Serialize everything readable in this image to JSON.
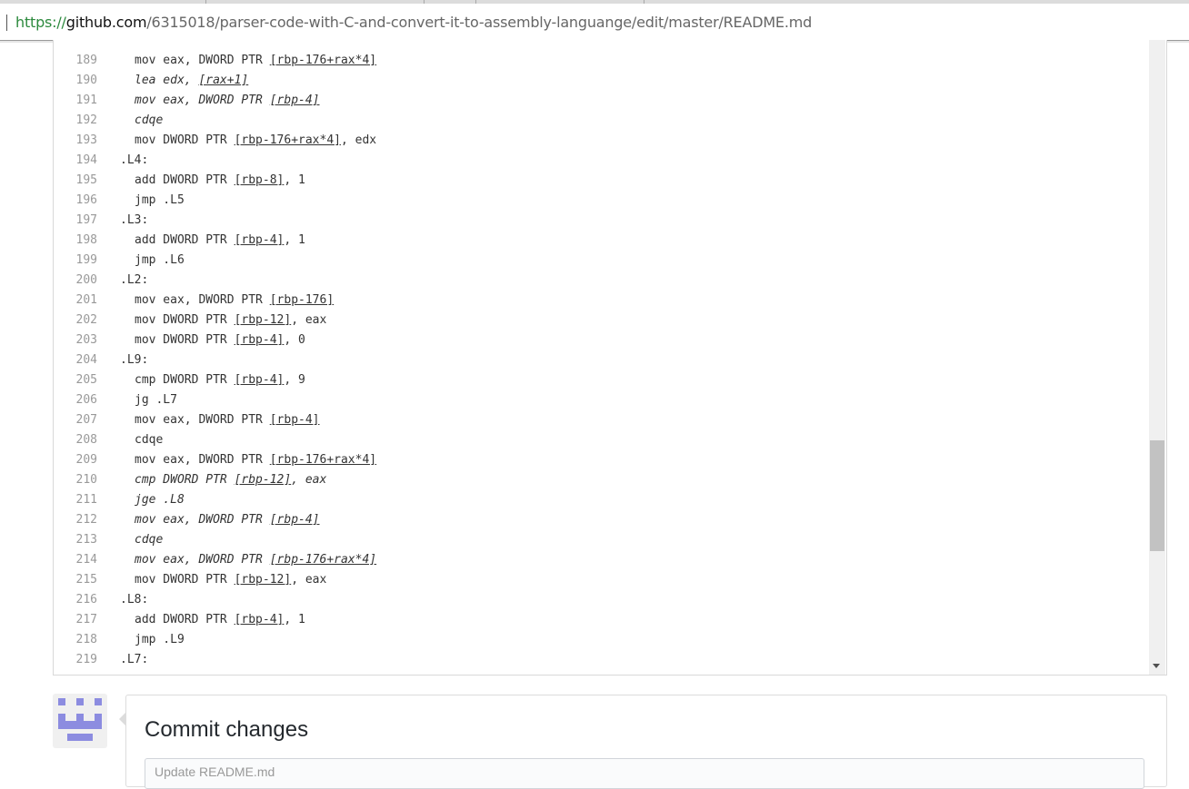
{
  "browser": {
    "url_scheme": "https://",
    "url_host": "github.com",
    "url_path": "/6315018/parser-code-with-C-and-convert-it-to-assembly-languange/edit/master/README.md"
  },
  "editor": {
    "lines": [
      {
        "n": "189",
        "indent": true,
        "italic": false,
        "segs": [
          {
            "t": "mov eax, DWORD PTR "
          },
          {
            "t": "[rbp-176+rax*4]",
            "m": true
          }
        ]
      },
      {
        "n": "190",
        "indent": true,
        "italic": true,
        "segs": [
          {
            "t": "lea edx, "
          },
          {
            "t": "[rax+1]",
            "m": true
          }
        ]
      },
      {
        "n": "191",
        "indent": true,
        "italic": true,
        "segs": [
          {
            "t": "mov eax, DWORD PTR "
          },
          {
            "t": "[rbp-4]",
            "m": true
          }
        ]
      },
      {
        "n": "192",
        "indent": true,
        "italic": true,
        "segs": [
          {
            "t": "cdqe"
          }
        ]
      },
      {
        "n": "193",
        "indent": true,
        "italic": false,
        "segs": [
          {
            "t": "mov DWORD PTR "
          },
          {
            "t": "[rbp-176+rax*4]",
            "m": true
          },
          {
            "t": ", edx"
          }
        ]
      },
      {
        "n": "194",
        "indent": false,
        "italic": false,
        "segs": [
          {
            "t": ".L4:"
          }
        ]
      },
      {
        "n": "195",
        "indent": true,
        "italic": false,
        "segs": [
          {
            "t": "add DWORD PTR "
          },
          {
            "t": "[rbp-8]",
            "m": true
          },
          {
            "t": ", 1"
          }
        ]
      },
      {
        "n": "196",
        "indent": true,
        "italic": false,
        "segs": [
          {
            "t": "jmp .L5"
          }
        ]
      },
      {
        "n": "197",
        "indent": false,
        "italic": false,
        "segs": [
          {
            "t": ".L3:"
          }
        ]
      },
      {
        "n": "198",
        "indent": true,
        "italic": false,
        "segs": [
          {
            "t": "add DWORD PTR "
          },
          {
            "t": "[rbp-4]",
            "m": true
          },
          {
            "t": ", 1"
          }
        ]
      },
      {
        "n": "199",
        "indent": true,
        "italic": false,
        "segs": [
          {
            "t": "jmp .L6"
          }
        ]
      },
      {
        "n": "200",
        "indent": false,
        "italic": false,
        "segs": [
          {
            "t": ".L2:"
          }
        ]
      },
      {
        "n": "201",
        "indent": true,
        "italic": false,
        "segs": [
          {
            "t": "mov eax, DWORD PTR "
          },
          {
            "t": "[rbp-176]",
            "m": true
          }
        ]
      },
      {
        "n": "202",
        "indent": true,
        "italic": false,
        "segs": [
          {
            "t": "mov DWORD PTR "
          },
          {
            "t": "[rbp-12]",
            "m": true
          },
          {
            "t": ", eax"
          }
        ]
      },
      {
        "n": "203",
        "indent": true,
        "italic": false,
        "segs": [
          {
            "t": "mov DWORD PTR "
          },
          {
            "t": "[rbp-4]",
            "m": true
          },
          {
            "t": ", 0"
          }
        ]
      },
      {
        "n": "204",
        "indent": false,
        "italic": false,
        "segs": [
          {
            "t": ".L9:"
          }
        ]
      },
      {
        "n": "205",
        "indent": true,
        "italic": false,
        "segs": [
          {
            "t": "cmp DWORD PTR "
          },
          {
            "t": "[rbp-4]",
            "m": true
          },
          {
            "t": ", 9"
          }
        ]
      },
      {
        "n": "206",
        "indent": true,
        "italic": false,
        "segs": [
          {
            "t": "jg .L7"
          }
        ]
      },
      {
        "n": "207",
        "indent": true,
        "italic": false,
        "segs": [
          {
            "t": "mov eax, DWORD PTR "
          },
          {
            "t": "[rbp-4]",
            "m": true
          }
        ]
      },
      {
        "n": "208",
        "indent": true,
        "italic": false,
        "segs": [
          {
            "t": "cdqe"
          }
        ]
      },
      {
        "n": "209",
        "indent": true,
        "italic": false,
        "segs": [
          {
            "t": "mov eax, DWORD PTR "
          },
          {
            "t": "[rbp-176+rax*4]",
            "m": true
          }
        ]
      },
      {
        "n": "210",
        "indent": true,
        "italic": true,
        "segs": [
          {
            "t": "cmp DWORD PTR "
          },
          {
            "t": "[rbp-12]",
            "m": true
          },
          {
            "t": ", eax"
          }
        ]
      },
      {
        "n": "211",
        "indent": true,
        "italic": true,
        "segs": [
          {
            "t": "jge .L8"
          }
        ]
      },
      {
        "n": "212",
        "indent": true,
        "italic": true,
        "segs": [
          {
            "t": "mov eax, DWORD PTR "
          },
          {
            "t": "[rbp-4]",
            "m": true
          }
        ]
      },
      {
        "n": "213",
        "indent": true,
        "italic": true,
        "segs": [
          {
            "t": "cdqe"
          }
        ]
      },
      {
        "n": "214",
        "indent": true,
        "italic": true,
        "segs": [
          {
            "t": "mov eax, DWORD PTR "
          },
          {
            "t": "[rbp-176+rax*4]",
            "m": true
          }
        ]
      },
      {
        "n": "215",
        "indent": true,
        "italic": false,
        "segs": [
          {
            "t": "mov DWORD PTR "
          },
          {
            "t": "[rbp-12]",
            "m": true
          },
          {
            "t": ", eax"
          }
        ]
      },
      {
        "n": "216",
        "indent": false,
        "italic": false,
        "segs": [
          {
            "t": ".L8:"
          }
        ]
      },
      {
        "n": "217",
        "indent": true,
        "italic": false,
        "segs": [
          {
            "t": "add DWORD PTR "
          },
          {
            "t": "[rbp-4]",
            "m": true
          },
          {
            "t": ", 1"
          }
        ]
      },
      {
        "n": "218",
        "indent": true,
        "italic": false,
        "segs": [
          {
            "t": "jmp .L9"
          }
        ]
      },
      {
        "n": "219",
        "indent": false,
        "italic": false,
        "segs": [
          {
            "t": ".L7:"
          }
        ]
      }
    ]
  },
  "commit": {
    "title": "Commit changes",
    "summary_placeholder": "Update README.md"
  },
  "colors": {
    "avatar": "#8c8ce0",
    "url_scheme": "#2d8a3e"
  }
}
